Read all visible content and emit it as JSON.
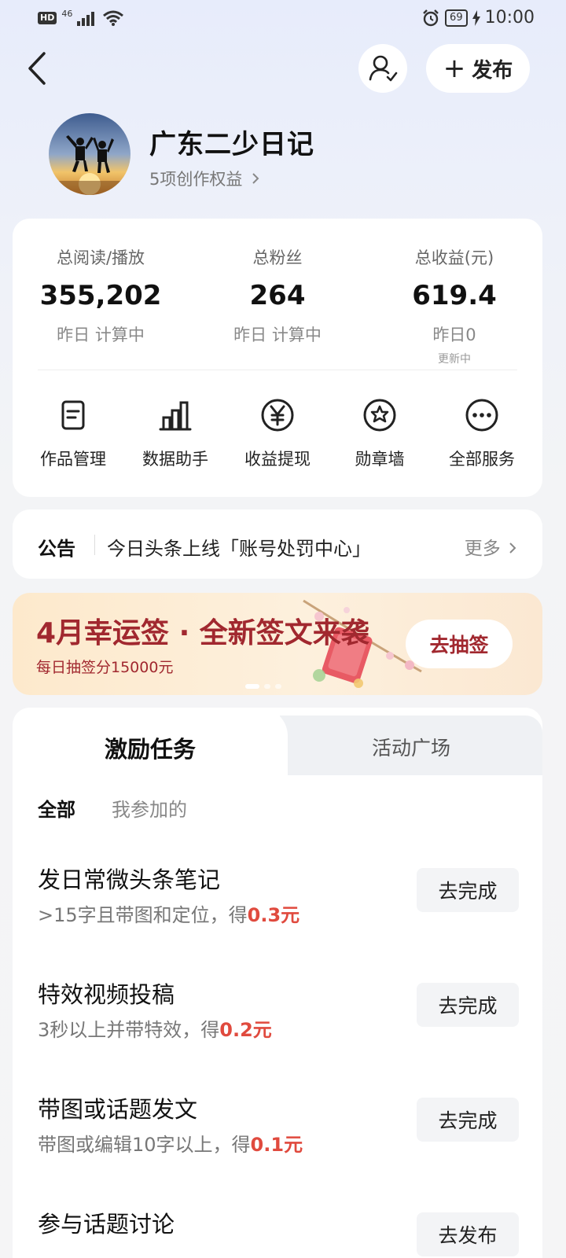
{
  "status_bar": {
    "hd": "HD",
    "network": "46",
    "battery": "69",
    "time": "10:00"
  },
  "header": {
    "publish_label": "发布"
  },
  "profile": {
    "name": "广东二少日记",
    "benefits": "5项创作权益"
  },
  "stats": [
    {
      "label": "总阅读/播放",
      "value": "355,202",
      "sub": "昨日 计算中",
      "note": ""
    },
    {
      "label": "总粉丝",
      "value": "264",
      "sub": "昨日 计算中",
      "note": ""
    },
    {
      "label": "总收益(元)",
      "value": "619.4",
      "sub": "昨日0",
      "note": "更新中"
    }
  ],
  "services": [
    {
      "label": "作品管理",
      "icon": "document-icon"
    },
    {
      "label": "数据助手",
      "icon": "bar-chart-icon"
    },
    {
      "label": "收益提现",
      "icon": "yuan-icon"
    },
    {
      "label": "勋章墙",
      "icon": "medal-icon"
    },
    {
      "label": "全部服务",
      "icon": "more-icon"
    }
  ],
  "notice": {
    "title": "公告",
    "text": "今日头条上线「账号处罚中心」",
    "more": "更多"
  },
  "banner": {
    "title": "4月幸运签 · 全新签文来袭",
    "subtitle": "每日抽签分15000元",
    "button": "去抽签",
    "page_count": 3,
    "active_page": 1
  },
  "tasks_section": {
    "tabs": [
      "激励任务",
      "活动广场"
    ],
    "active_tab": 0,
    "filters": [
      "全部",
      "我参加的"
    ],
    "active_filter": 0,
    "items": [
      {
        "title": "发日常微头条笔记",
        "desc": ">15字且带图和定位，得",
        "reward": "0.3元",
        "button": "去完成"
      },
      {
        "title": "特效视频投稿",
        "desc": "3秒以上并带特效，得",
        "reward": "0.2元",
        "button": "去完成"
      },
      {
        "title": "带图或话题发文",
        "desc": "带图或编辑10字以上，得",
        "reward": "0.1元",
        "button": "去完成"
      },
      {
        "title": "参与话题讨论",
        "desc": "",
        "reward": "",
        "button": "去发布"
      }
    ]
  },
  "colors": {
    "accent_red": "#e04a3e",
    "banner_red": "#a1282f",
    "page_bg_top": "#e7ecfb"
  }
}
